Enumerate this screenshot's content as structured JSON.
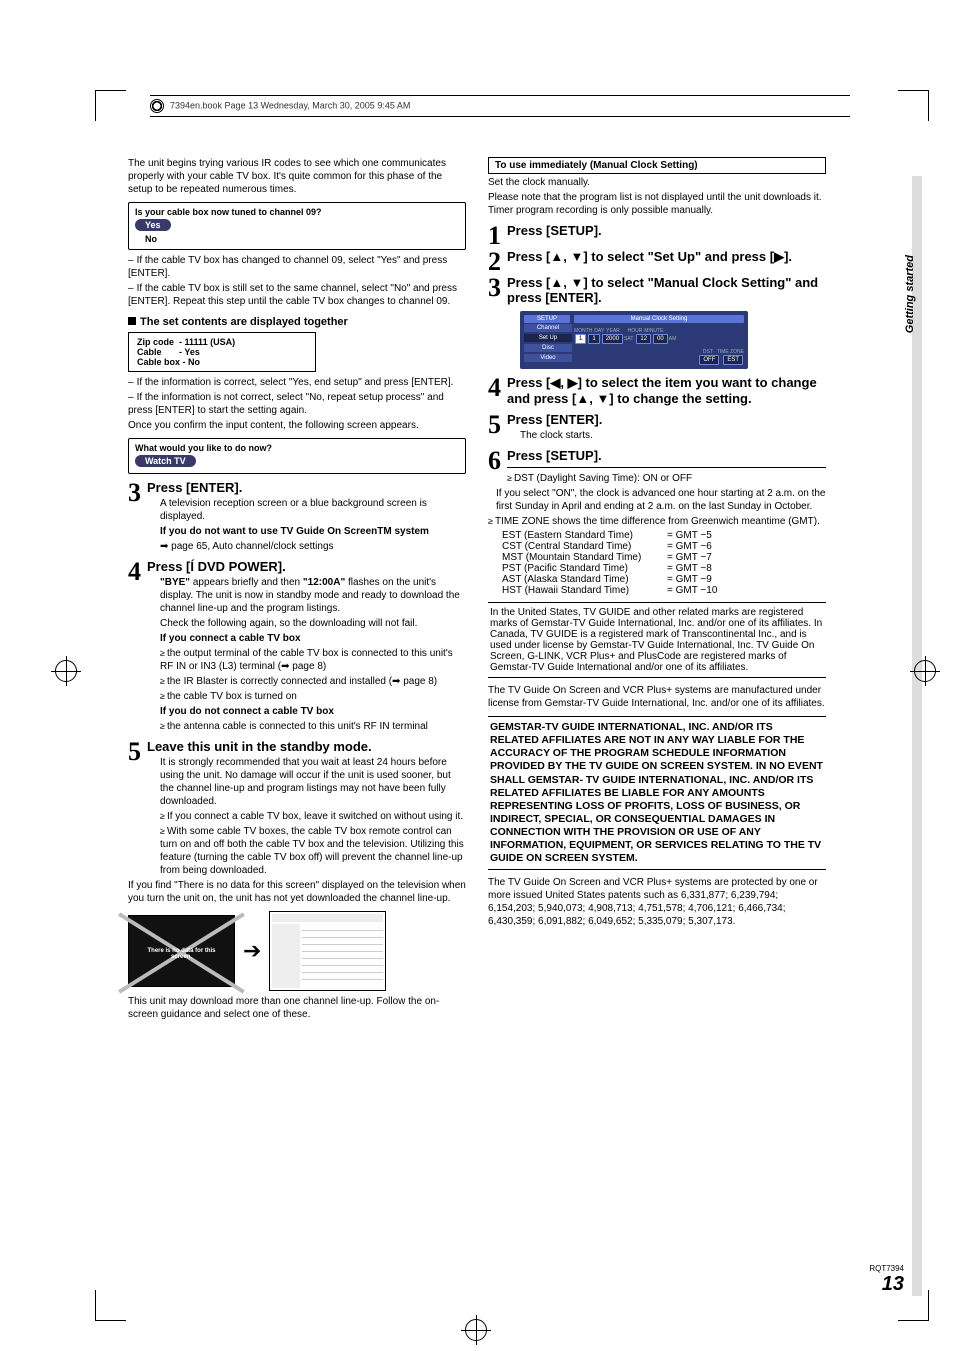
{
  "header_text": "7394en.book  Page 13  Wednesday, March 30, 2005  9:45 AM",
  "side_label": "Getting started",
  "left": {
    "intro": "The unit begins trying various IR codes to see which one communicates properly with your cable TV box. It's quite common for this phase of the setup to be repeated numerous times.",
    "prompt1": "Is your cable box now tuned to channel 09?",
    "yes": "Yes",
    "no": "No",
    "dash1": "If the cable TV box has changed to channel 09, select \"Yes\" and press [ENTER].",
    "dash2": "If the cable TV box is still set to the same channel, select \"No\" and press [ENTER]. Repeat this step until the cable TV box changes to channel 09.",
    "sec_title": "The set contents are displayed together",
    "zip_l": "Zip code",
    "zip_v": "- 11111 (USA)",
    "cable_l": "Cable",
    "cable_v": "- Yes",
    "box_l": "Cable box",
    "box_v": "- No",
    "dash3": "If the information is correct, select \"Yes, end setup\" and press [ENTER].",
    "dash4": "If the information is not correct, select \"No, repeat setup process\" and press [ENTER] to start the setting again.",
    "confirm": "Once you confirm the input content, the following screen appears.",
    "prompt2": "What would you like to do now?",
    "watch": "Watch TV",
    "s3_t": "Press [ENTER].",
    "s3_b": "A television reception screen or a blue background screen is displayed.",
    "s3_note": "If you do not want to use TV Guide On ScreenTM system",
    "s3_ref": "page 65, Auto channel/clock settings",
    "s4_t": "Press [Í DVD POWER].",
    "s4_b1a": "\"BYE\"",
    "s4_b1b": " appears briefly and then ",
    "s4_b1c": "\"12:00A\"",
    "s4_b1d": " flashes on the unit's display. The unit is now in standby mode and ready to download the channel line-up and the program listings.",
    "s4_check": "Check the following again, so the downloading will not fail.",
    "s4_if1": "If you connect a cable TV box",
    "s4_li1": "the output terminal of the cable TV box is connected to this unit's RF IN or IN3 (L3) terminal (➡ page 8)",
    "s4_li2": "the IR Blaster is correctly connected and installed (➡ page 8)",
    "s4_li3": "the cable TV box is turned on",
    "s4_if2": "If you do not connect a cable TV box",
    "s4_li4": "the antenna cable is connected to this unit's RF IN terminal",
    "s5_t": "Leave this unit in the standby mode.",
    "s5_b1": "It is strongly recommended that you wait at least 24 hours before using the unit. No damage will occur if the unit is used sooner, but the channel line-up and program listings may not have been fully downloaded.",
    "s5_li1": "If you connect a cable TV box, leave it switched on without using it.",
    "s5_li2": "With some cable TV boxes, the cable TV box remote control can turn on and off both the cable TV box and the television. Utilizing this feature (turning the cable TV box off) will prevent the channel line-up from being downloaded.",
    "nodata": "If you find \"There is no data for this screen\" displayed on the television when you turn the unit on, the unit has not yet downloaded the channel line-up.",
    "scr_msg": "There is no data for this screen.",
    "closing": "This unit may download more than one channel line-up. Follow the on-screen guidance and select one of these."
  },
  "right": {
    "box_title": "To use immediately (Manual Clock Setting)",
    "p1": "Set the clock manually.",
    "p2": "Please note that the program list is not displayed until the unit downloads it. Timer program recording is only possible manually.",
    "s1": "Press [SETUP].",
    "s2": "Press [▲, ▼] to select \"Set Up\" and press [▶].",
    "s3": "Press [▲, ▼] to select \"Manual Clock Setting\" and press [ENTER].",
    "osd": {
      "title": "SETUP",
      "panel": "Manual Clock Setting",
      "tabs": [
        "Channel",
        "Set Up",
        "Disc",
        "Video"
      ],
      "cols": [
        "MONTH",
        "DAY",
        "YEAR",
        "",
        "HOUR",
        "MINUTE",
        ""
      ],
      "vals": [
        "1",
        "1",
        "2000",
        "SAT",
        "12",
        "00",
        "AM"
      ],
      "sub": [
        "DST",
        "TIME ZONE"
      ],
      "subv": [
        "OFF",
        "EST"
      ]
    },
    "s4": "Press [◀, ▶] to select the item you want to change and press [▲, ▼] to change the setting.",
    "s5": "Press [ENTER].",
    "s5b": "The clock starts.",
    "s6": "Press [SETUP].",
    "dst_h": "DST (Daylight Saving Time): ON or OFF",
    "dst_b": "If you select \"ON\", the clock is advanced one hour starting at 2 a.m. on the first Sunday in April and ending at 2 a.m. on the last Sunday in October.",
    "tz_h": "TIME ZONE shows the time difference from Greenwich meantime (GMT).",
    "tz": [
      {
        "n": "EST (Eastern Standard Time)",
        "v": "= GMT −5"
      },
      {
        "n": "CST (Central Standard Time)",
        "v": "= GMT −6"
      },
      {
        "n": "MST (Mountain Standard Time)",
        "v": "= GMT −7"
      },
      {
        "n": "PST (Pacific Standard Time)",
        "v": "= GMT −8"
      },
      {
        "n": "AST (Alaska Standard Time)",
        "v": "= GMT −9"
      },
      {
        "n": "HST (Hawaii Standard Time)",
        "v": "= GMT −10"
      }
    ],
    "note1": "In the United States, TV GUIDE and other related marks are registered marks of Gemstar-TV Guide International, Inc. and/or one of its affiliates. In Canada, TV GUIDE is a registered mark of Transcontinental Inc., and is used under license by Gemstar-TV Guide International, Inc. TV Guide On Screen, G-LINK, VCR Plus+ and PlusCode are registered marks of Gemstar-TV Guide International and/or one of its affiliates.",
    "note2": "The TV Guide On Screen and VCR Plus+ systems are manufactured under license from Gemstar-TV Guide International, Inc. and/or one of its affiliates.",
    "legal": "GEMSTAR-TV GUIDE INTERNATIONAL, INC. AND/OR ITS RELATED AFFILIATES ARE NOT IN ANY WAY LIABLE FOR THE ACCURACY OF THE PROGRAM SCHEDULE INFORMATION PROVIDED BY THE TV GUIDE ON SCREEN SYSTEM. IN NO EVENT SHALL GEMSTAR- TV GUIDE INTERNATIONAL, INC. AND/OR ITS RELATED AFFILIATES BE LIABLE FOR ANY AMOUNTS REPRESENTING LOSS OF PROFITS, LOSS OF BUSINESS, OR INDIRECT, SPECIAL, OR CONSEQUENTIAL DAMAGES IN CONNECTION WITH THE PROVISION OR USE OF ANY INFORMATION, EQUIPMENT, OR SERVICES RELATING TO THE TV GUIDE ON SCREEN SYSTEM.",
    "note3": "The TV Guide On Screen and VCR Plus+ systems are protected by one or more issued United States patents such as 6,331,877; 6,239,794; 6,154,203; 5,940,073; 4,908,713; 4,751,578; 4,706,121; 6,466,734; 6,430,359; 6,091,882; 6,049,652; 5,335,079; 5,307,173."
  },
  "footer": {
    "code": "RQT7394",
    "page": "13"
  }
}
